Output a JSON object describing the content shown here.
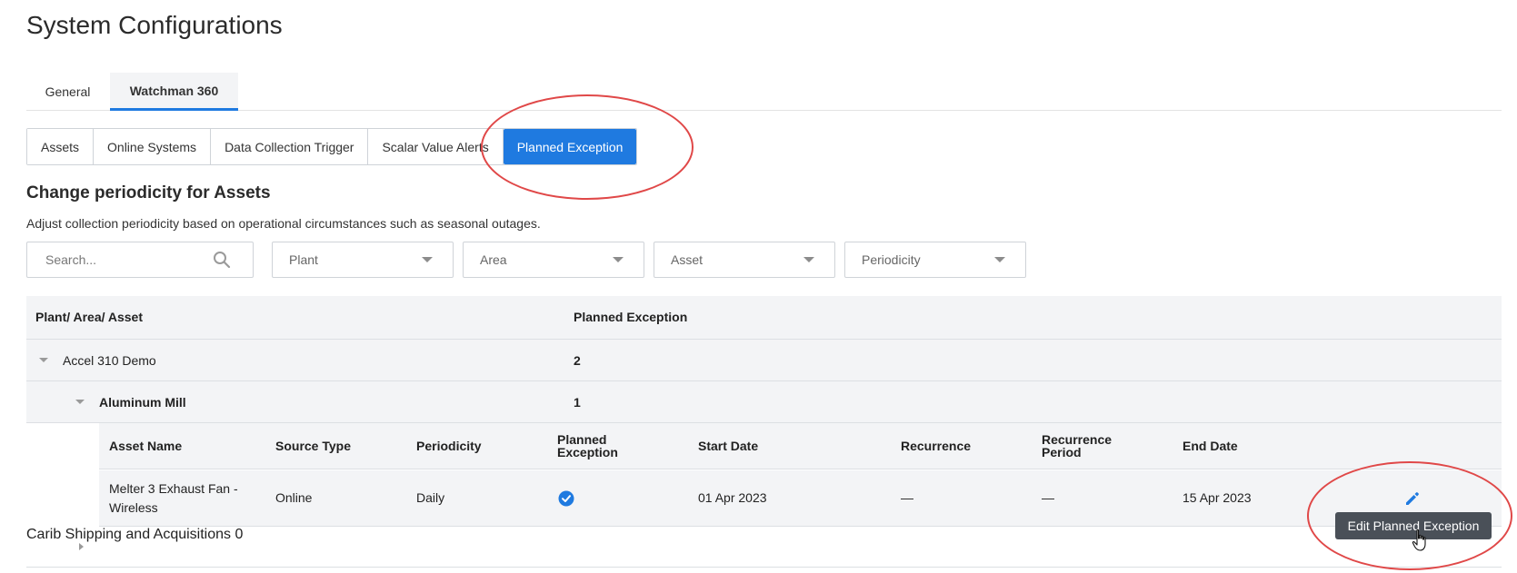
{
  "page": {
    "title": "System Configurations"
  },
  "main_tabs": {
    "general": "General",
    "watchman": "Watchman 360"
  },
  "sub_tabs": [
    "Assets",
    "Online Systems",
    "Data Collection Trigger",
    "Scalar Value Alerts",
    "Planned Exception"
  ],
  "section": {
    "title": "Change periodicity for Assets",
    "description": "Adjust collection periodicity based on operational circumstances such as seasonal outages."
  },
  "filters": {
    "search_placeholder": "Search...",
    "plant": "Plant",
    "area": "Area",
    "asset": "Asset",
    "periodicity": "Periodicity"
  },
  "table": {
    "headers": {
      "hierarchy": "Plant/ Area/ Asset",
      "planned_exception": "Planned Exception"
    },
    "plant_row": {
      "name": "Accel 310 Demo",
      "count": "2"
    },
    "area_row": {
      "name": "Aluminum Mill",
      "count": "1"
    },
    "asset_headers": {
      "asset_name": "Asset Name",
      "source_type": "Source Type",
      "periodicity": "Periodicity",
      "planned_exception_1": "Planned",
      "planned_exception_2": "Exception",
      "start_date": "Start Date",
      "recurrence": "Recurrence",
      "recurrence_period_1": "Recurrence",
      "recurrence_period_2": "Period",
      "end_date": "End Date"
    },
    "asset_row": {
      "name_line1": "Melter 3 Exhaust Fan -",
      "name_line2": "Wireless",
      "source_type": "Online",
      "periodicity": "Daily",
      "start_date": "01 Apr 2023",
      "recurrence": "—",
      "recurrence_period": "—",
      "end_date": "15 Apr 2023"
    },
    "carib_row": {
      "name": "Carib Shipping and Acquisitions",
      "count": "0"
    }
  },
  "tooltip": {
    "text": "Edit Planned Exception"
  },
  "colors": {
    "accent": "#1f7ae0",
    "annotation": "#e04848",
    "tooltip_bg": "#4a5058"
  },
  "icons": [
    "search-icon",
    "chevron-down-icon",
    "check-circle-icon",
    "pencil-icon",
    "hand-cursor-icon"
  ]
}
